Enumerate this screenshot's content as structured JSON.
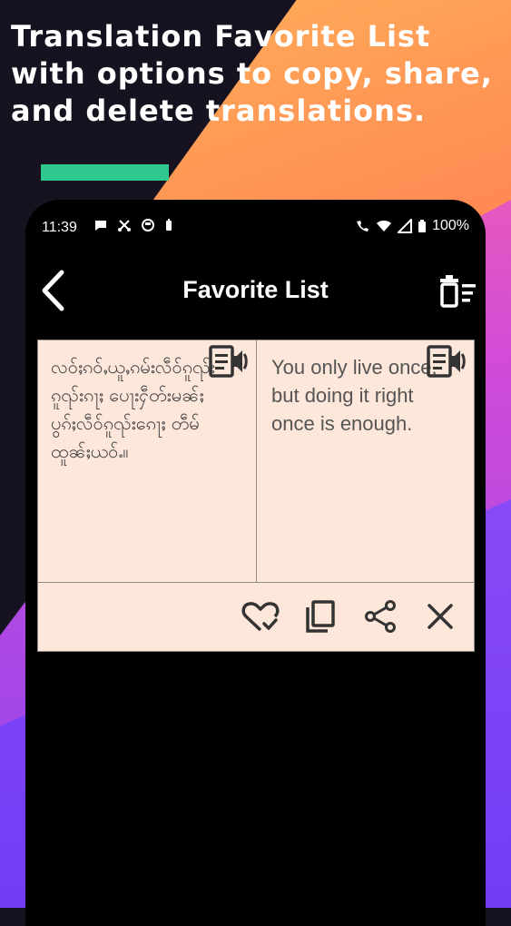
{
  "promo": {
    "headline": "Translation Favorite List with options to copy, share, and delete translations."
  },
  "status_bar": {
    "time": "11:39",
    "battery": "100%"
  },
  "app_bar": {
    "title": "Favorite List"
  },
  "favorites": [
    {
      "source_text": "လဝ်ႈၵဝ်ႇယူႇၵမ်းလဵဝ်ၵူၺ်း ၵူၺ်းၵႃႈ ပေႃးႁဵတ်းမၼ်ႈ ပွၵ်ႈလဵဝ်ၵူၺ်းၵေႃႈ တဵမ်ထူၼ်ႈယဝ်ႉ။",
      "translated_text": "You only live once, but doing it right once is enough."
    }
  ],
  "colors": {
    "accent_bar": "#2fc98f",
    "card_bg": "#fde6da",
    "icon": "#333333"
  },
  "icons": {
    "back": "chevron-left-icon",
    "clear_all": "trash-list-icon",
    "speak": "speaker-note-icon",
    "favorite": "heart-check-icon",
    "copy": "copy-icon",
    "share": "share-icon",
    "delete": "close-icon"
  }
}
